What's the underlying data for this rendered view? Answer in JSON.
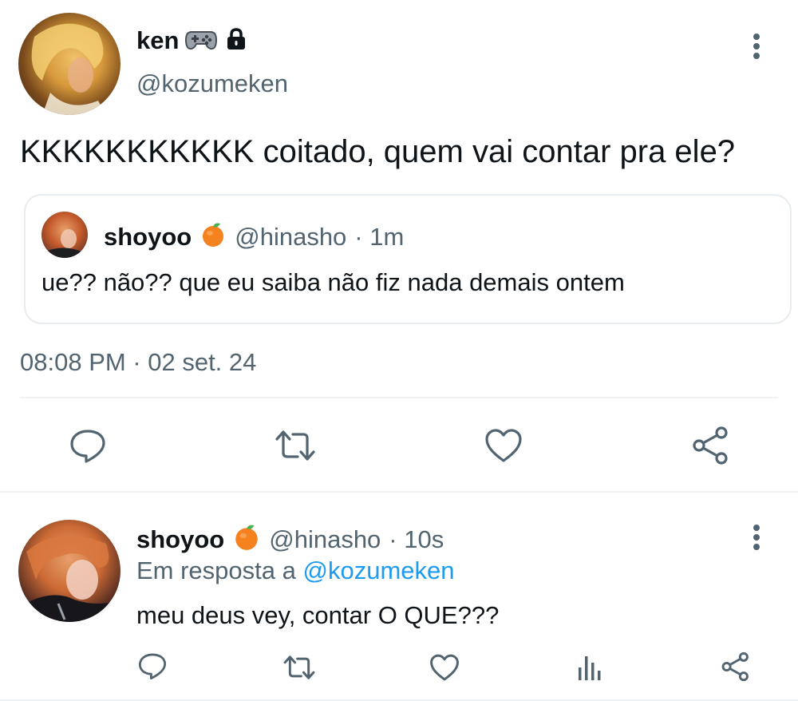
{
  "main_tweet": {
    "author_name": "ken",
    "author_badges": [
      "gamepad-emoji",
      "lock-icon"
    ],
    "author_handle": "@kozumeken",
    "text": "KKKKKKKKKKK coitado, quem vai contar pra ele?",
    "timestamp": "08:08 PM · 02 set. 24",
    "quoted": {
      "author_name": "shoyoo",
      "author_emoji": "tangerine-emoji",
      "author_handle": "@hinasho",
      "time": "· 1m",
      "text": "ue?? não?? que eu saiba não fiz nada demais ontem"
    },
    "actions": [
      "reply-icon",
      "retweet-icon",
      "like-icon",
      "share-icon"
    ]
  },
  "reply_tweet": {
    "author_name": "shoyoo",
    "author_emoji": "tangerine-emoji",
    "author_handle": "@hinasho",
    "time": "· 10s",
    "reply_prefix": "Em resposta a",
    "reply_to": "@kozumeken",
    "text": "meu deus vey, contar O QUE???",
    "actions": [
      "reply-icon",
      "retweet-icon",
      "like-icon",
      "analytics-icon",
      "share-icon"
    ]
  },
  "colors": {
    "text": "#0f1419",
    "muted": "#536471",
    "link": "#1d9bf0",
    "border": "#e6ecf0"
  }
}
